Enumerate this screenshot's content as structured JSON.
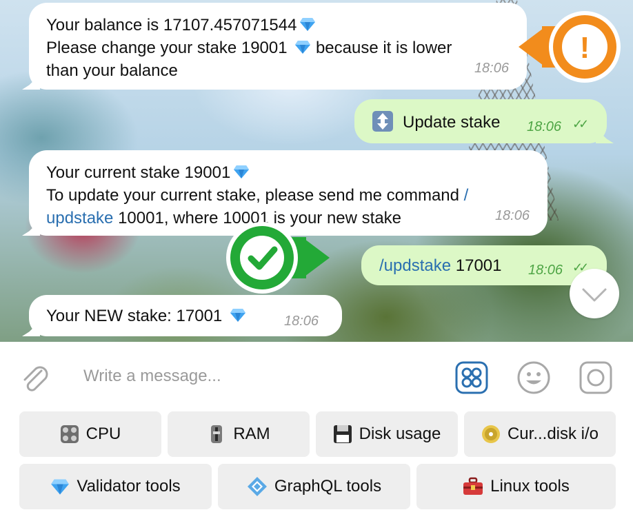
{
  "messages": {
    "m1": {
      "line1": "Your balance is 17107.457071544",
      "line2a": "Please change your stake 19001",
      "line2b": "because it is lower",
      "line3": "than your balance",
      "time": "18:06"
    },
    "m2": {
      "text": "Update stake",
      "time": "18:06"
    },
    "m3": {
      "line1": "Your current stake 19001",
      "line2a": "To update your current stake, please send me command",
      "line2b": "/",
      "line3a": "updstake",
      "line3b": "10001, where 10001 is your new stake",
      "time": "18:06"
    },
    "m4": {
      "command": "/updstake",
      "value": "17001",
      "time": "18:06"
    },
    "m5": {
      "text": "Your NEW stake: 17001",
      "time": "18:06"
    }
  },
  "annotations": {
    "warn_symbol": "!",
    "warn_color": "#f28c1c",
    "ok_color": "#23a937"
  },
  "composer": {
    "placeholder": "Write a message..."
  },
  "keyboard": {
    "row1": [
      {
        "icon": "control-knobs-icon",
        "label": "CPU"
      },
      {
        "icon": "level-slider-icon",
        "label": "RAM"
      },
      {
        "icon": "floppy-disk-icon",
        "label": "Disk usage"
      },
      {
        "icon": "dvd-icon",
        "label": "Cur...disk i/o"
      }
    ],
    "row2": [
      {
        "icon": "gem-icon",
        "label": "Validator tools"
      },
      {
        "icon": "diamond-shape-icon",
        "label": "GraphQL tools"
      },
      {
        "icon": "toolbox-icon",
        "label": "Linux tools"
      }
    ]
  }
}
